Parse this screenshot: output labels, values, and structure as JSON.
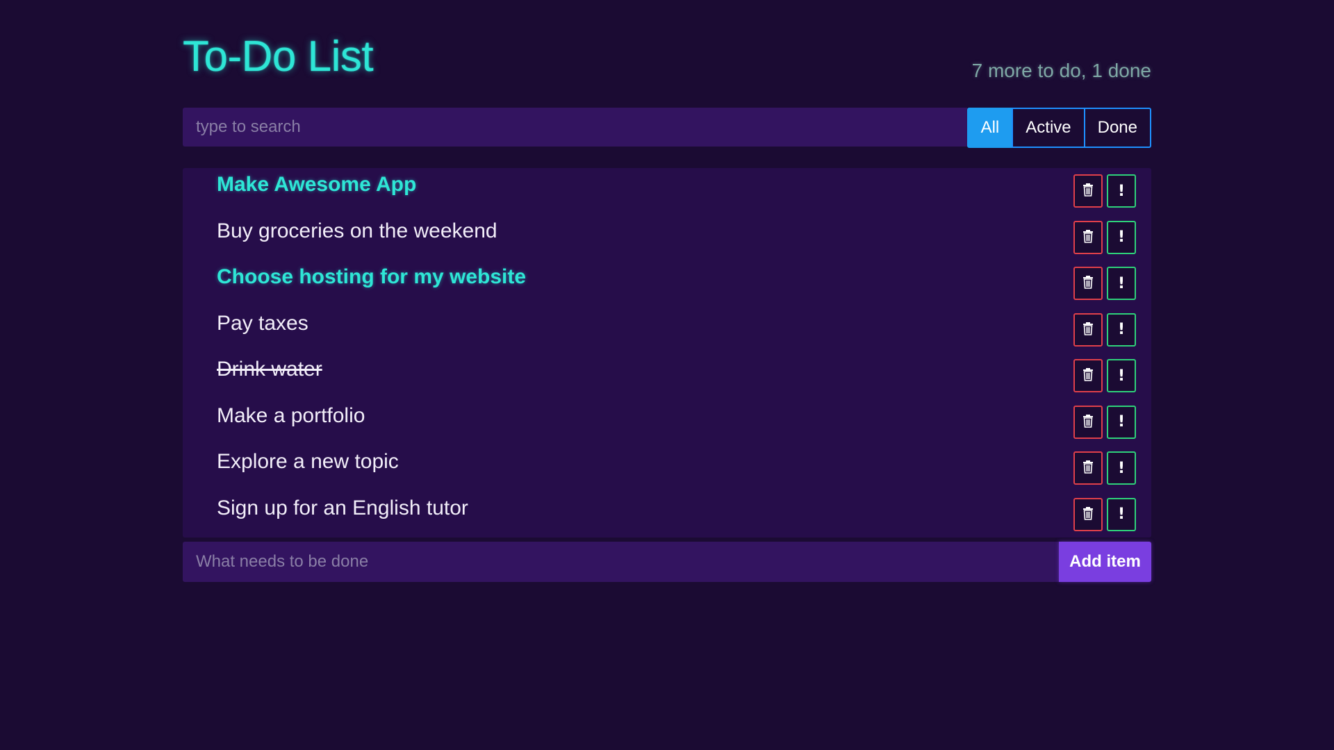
{
  "header": {
    "title": "To-Do List",
    "status": "7 more to do, 1 done"
  },
  "search": {
    "placeholder": "type to search",
    "value": ""
  },
  "filters": [
    {
      "label": "All",
      "active": true
    },
    {
      "label": "Active",
      "active": false
    },
    {
      "label": "Done",
      "active": false
    }
  ],
  "items": [
    {
      "label": "Make Awesome App",
      "important": true,
      "done": false
    },
    {
      "label": "Buy groceries on the weekend",
      "important": false,
      "done": false
    },
    {
      "label": "Choose hosting for my website",
      "important": true,
      "done": false
    },
    {
      "label": "Pay taxes",
      "important": false,
      "done": false
    },
    {
      "label": "Drink water",
      "important": false,
      "done": true
    },
    {
      "label": "Make a portfolio",
      "important": false,
      "done": false
    },
    {
      "label": "Explore a new topic",
      "important": false,
      "done": false
    },
    {
      "label": "Sign up for an English tutor",
      "important": false,
      "done": false
    }
  ],
  "item_actions": {
    "delete_icon": "trash-icon",
    "important_icon": "exclamation-icon",
    "important_glyph": "!"
  },
  "add": {
    "placeholder": "What needs to be done",
    "value": "",
    "button_label": "Add item"
  },
  "colors": {
    "background": "#1b0b33",
    "accent": "#2ee6d6",
    "filter_active": "#1e9cf0",
    "delete_border": "#e0404a",
    "important_border": "#2ed27a",
    "add_button": "#7a3ee0"
  }
}
